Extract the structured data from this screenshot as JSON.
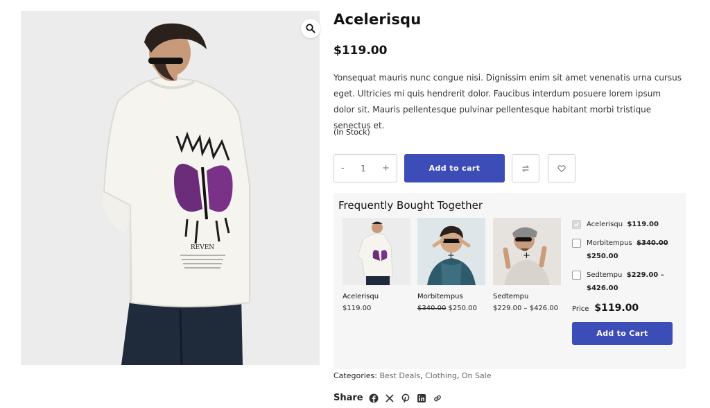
{
  "product": {
    "title": "Acelerisqu",
    "price": "$119.00",
    "description": "Yonsequat mauris nunc congue nisi. Dignissim enim sit amet venenatis urna cursus eget. Ultricies mi quis hendrerit dolor. Faucibus interdum posuere lorem ipsum dolor sit. Mauris pellentesque pulvinar pellentesque habitant morbi tristique senectus et.",
    "stock": "(In Stock)",
    "print_text": "REVEN",
    "icons": {
      "zoom": "search-icon",
      "compare": "compare-arrows-icon",
      "wishlist": "heart-icon"
    }
  },
  "cart": {
    "minus": "-",
    "quantity": "1",
    "plus": "+",
    "add_label": "Add to cart"
  },
  "fbt": {
    "title": "Frequently Bought Together",
    "plus_sign": "+",
    "products": [
      {
        "name": "Acelerisqu",
        "price": "$119.00",
        "old_price": ""
      },
      {
        "name": "Morbitempus",
        "price": "$250.00",
        "old_price": "$340.00"
      },
      {
        "name": "Sedtempu",
        "price": "$229.00 – $426.00",
        "old_price": ""
      }
    ],
    "options": [
      {
        "name": "Acelerisqu",
        "price": "$119.00",
        "checked": true
      },
      {
        "name": "Morbitempus",
        "old_price": "$340.00",
        "price": "$250.00",
        "checked": false
      },
      {
        "name": "Sedtempu",
        "price": "$229.00 –",
        "price2": "$426.00",
        "checked": false
      }
    ],
    "total_label": "Price",
    "total_value": "$119.00",
    "add_label": "Add to Cart"
  },
  "meta": {
    "categories_label": "Categories:",
    "categories": [
      "Best Deals",
      "Clothing",
      "On Sale"
    ],
    "separator": ",",
    "share_label": "Share",
    "share_icons": [
      "facebook-icon",
      "x-icon",
      "pinterest-icon",
      "linkedin-icon",
      "link-icon"
    ]
  },
  "colors": {
    "accent": "#3c4db8",
    "background": "#ffffff",
    "panel": "#f6f6f6"
  }
}
